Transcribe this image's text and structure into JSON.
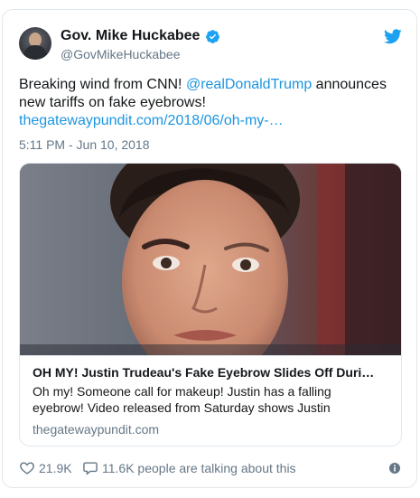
{
  "author": {
    "name": "Gov. Mike Huckabee",
    "handle": "@GovMikeHuckabee",
    "verified": true
  },
  "tweet": {
    "text_prefix": "Breaking wind from CNN!  ",
    "mention": "@realDonaldTrump",
    "text_suffix": " announces new tariffs on fake eyebrows!",
    "link": "thegatewaypundit.com/2018/06/oh-my-…",
    "timestamp": "5:11 PM - Jun 10, 2018"
  },
  "card": {
    "title": "OH MY! Justin Trudeau's Fake Eyebrow Slides Off Duri…",
    "description": "Oh my! Someone call for makeup! Justin has a falling eyebrow! Video released from Saturday shows Justin",
    "domain": "thegatewaypundit.com"
  },
  "footer": {
    "likes": "21.9K",
    "conversation": "11.6K people are talking about this"
  },
  "icons": {
    "brand": "twitter-bird-icon",
    "verified": "verified-badge-icon",
    "like": "heart-icon",
    "reply": "speech-bubble-icon",
    "info": "info-icon"
  },
  "colors": {
    "link": "#1b95e0",
    "secondary_text": "#657786",
    "border": "#e1e8ed",
    "twitter_blue": "#1da1f2"
  }
}
